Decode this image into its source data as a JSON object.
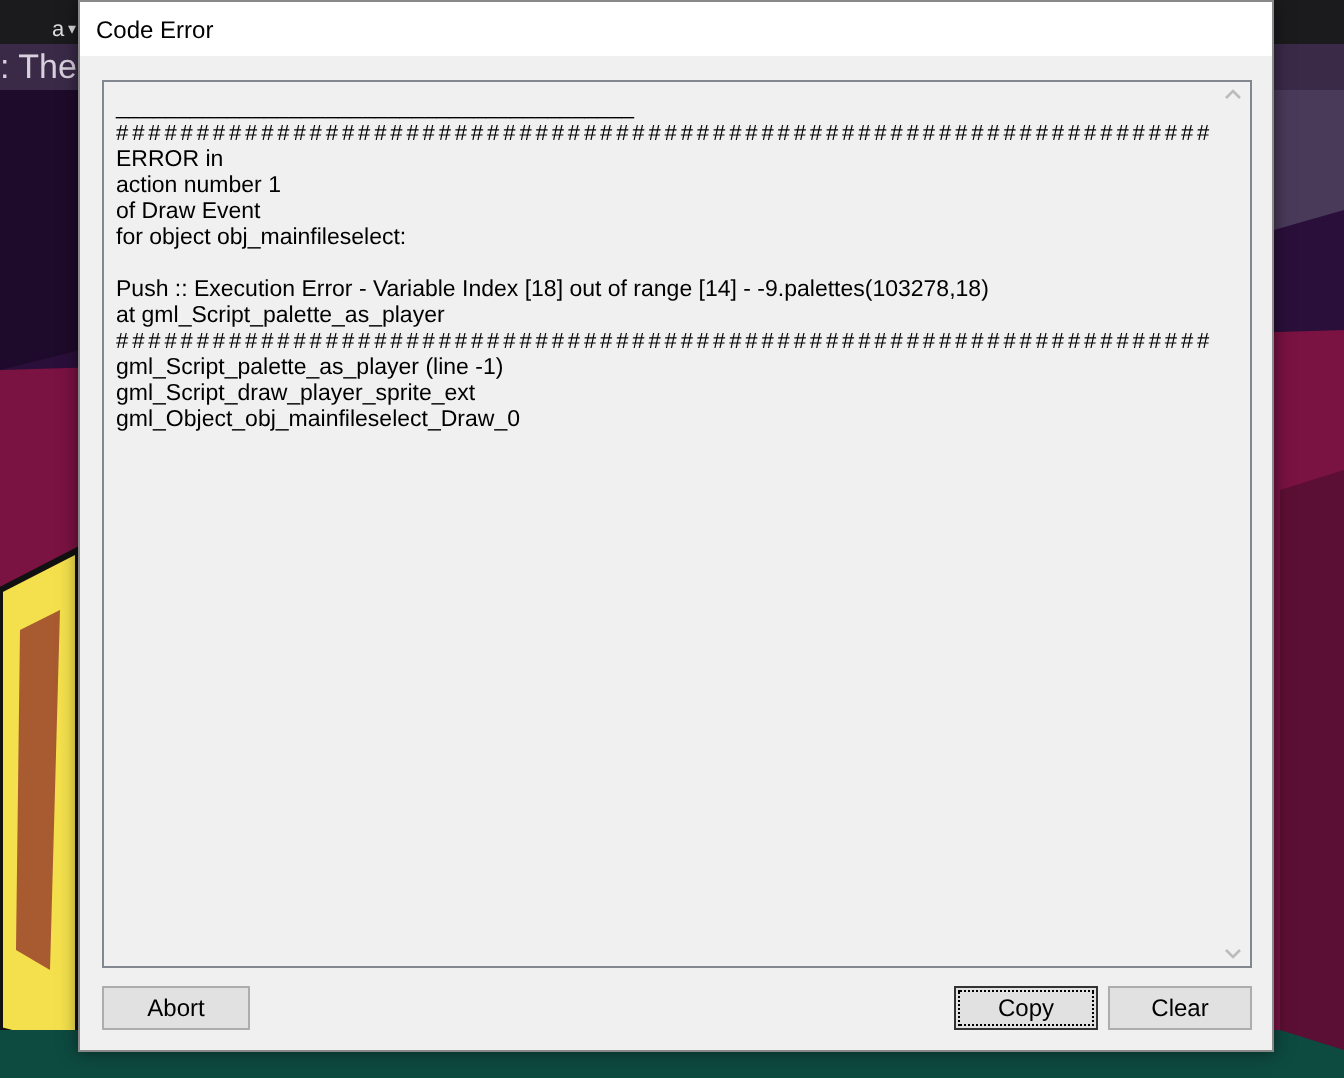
{
  "background": {
    "menu_fragment": "a",
    "menu_caret": "▾",
    "title_fragment": ": The"
  },
  "dialog": {
    "title": "Code Error",
    "lines": [
      {
        "kind": "rule",
        "text": "__________________________________________"
      },
      {
        "kind": "hashes",
        "text": "####################################################################"
      },
      {
        "kind": "text",
        "text": "ERROR in"
      },
      {
        "kind": "text",
        "text": "action number 1"
      },
      {
        "kind": "text",
        "text": "of Draw Event"
      },
      {
        "kind": "text",
        "text": "for object obj_mainfileselect:"
      },
      {
        "kind": "blank"
      },
      {
        "kind": "text",
        "text": "Push :: Execution Error - Variable Index [18] out of range [14] - -9.palettes(103278,18)"
      },
      {
        "kind": "text",
        "text": "at gml_Script_palette_as_player"
      },
      {
        "kind": "hashes",
        "text": "####################################################################"
      },
      {
        "kind": "text",
        "text": "gml_Script_palette_as_player (line -1)"
      },
      {
        "kind": "text",
        "text": "gml_Script_draw_player_sprite_ext"
      },
      {
        "kind": "text",
        "text": "gml_Object_obj_mainfileselect_Draw_0"
      }
    ],
    "buttons": [
      {
        "label": "Abort",
        "focused": false
      },
      {
        "label": "Copy",
        "focused": true
      },
      {
        "label": "Clear",
        "focused": false
      }
    ]
  }
}
